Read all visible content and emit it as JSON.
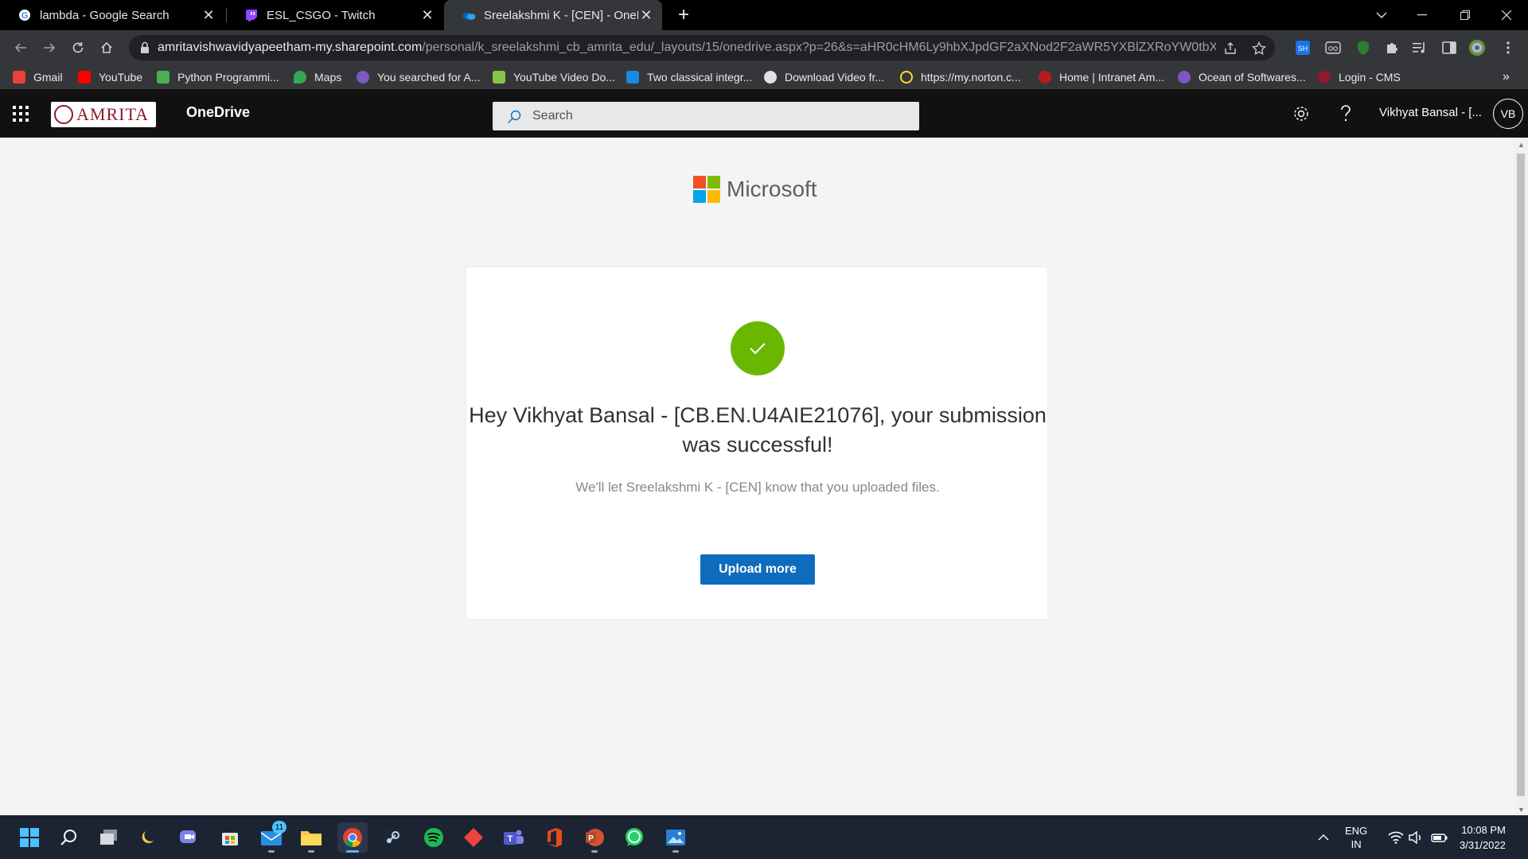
{
  "browser": {
    "tabs": [
      {
        "title": "lambda - Google Search",
        "icon": "google-icon"
      },
      {
        "title": "ESL_CSGO - Twitch",
        "icon": "twitch-icon"
      },
      {
        "title": "Sreelakshmi K - [CEN] - OneDrive",
        "icon": "onedrive-icon",
        "active": true
      }
    ],
    "close_glyph": "✕",
    "new_tab_glyph": "+",
    "url_host": "amritavishwavidyapeetham-my.sharepoint.com",
    "url_rest": "/personal/k_sreelakshmi_cb_amrita_edu/_layouts/15/onedrive.aspx?p=26&s=aHR0cHM6Ly9hbXJpdGF2aXNod2F2aWR5YXBlZXRoYW0tbXku...",
    "bookmarks": [
      {
        "label": "Gmail",
        "color": "#ea4335"
      },
      {
        "label": "YouTube",
        "color": "#ff0000"
      },
      {
        "label": "Python Programmi...",
        "color": "#4caf50"
      },
      {
        "label": "Maps",
        "color": "#34a853"
      },
      {
        "label": "You searched for A...",
        "color": "#7e57c2"
      },
      {
        "label": "YouTube Video Do...",
        "color": "#8bc34a"
      },
      {
        "label": "Two classical integr...",
        "color": "#1e88e5"
      },
      {
        "label": "Download Video fr...",
        "color": "#e0e0e0"
      },
      {
        "label": "https://my.norton.c...",
        "color": "#fdd835"
      },
      {
        "label": "Home | Intranet Am...",
        "color": "#b71c1c"
      },
      {
        "label": "Ocean of Softwares...",
        "color": "#7e57c2"
      },
      {
        "label": "Login - CMS",
        "color": "#8d1b2d"
      }
    ],
    "more_bookmarks": "»"
  },
  "suite": {
    "brand_text": "AMRITA",
    "app_name": "OneDrive",
    "search_placeholder": "Search",
    "user_name": "Vikhyat Bansal - [...",
    "avatar_initials": "VB"
  },
  "main": {
    "microsoft_label": "Microsoft",
    "headline": "Hey Vikhyat Bansal - [CB.EN.U4AIE21076], your submission was successful!",
    "subtext": "We'll let Sreelakshmi K - [CEN] know that you uploaded files.",
    "upload_more_label": "Upload more",
    "success_color": "#6bb700",
    "button_color": "#0f6cbd"
  },
  "taskbar": {
    "mail_badge": "11",
    "lang_line1": "ENG",
    "lang_line2": "IN",
    "time": "10:08 PM",
    "date": "3/31/2022"
  }
}
